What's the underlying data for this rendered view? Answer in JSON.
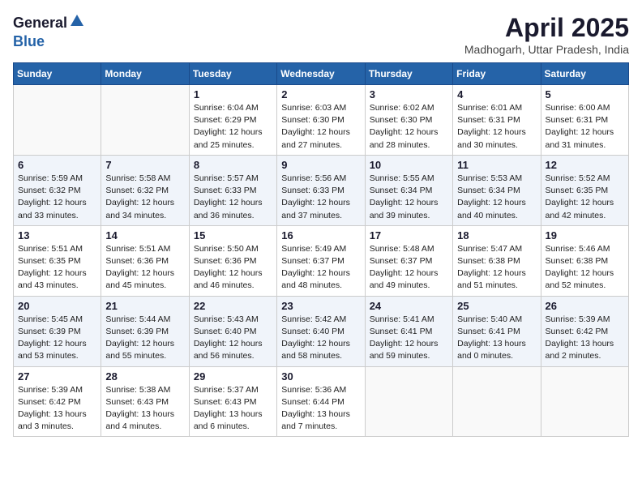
{
  "logo": {
    "general": "General",
    "blue": "Blue"
  },
  "title": "April 2025",
  "location": "Madhogarh, Uttar Pradesh, India",
  "weekdays": [
    "Sunday",
    "Monday",
    "Tuesday",
    "Wednesday",
    "Thursday",
    "Friday",
    "Saturday"
  ],
  "weeks": [
    [
      {
        "day": "",
        "sunrise": "",
        "sunset": "",
        "daylight": ""
      },
      {
        "day": "",
        "sunrise": "",
        "sunset": "",
        "daylight": ""
      },
      {
        "day": "1",
        "sunrise": "Sunrise: 6:04 AM",
        "sunset": "Sunset: 6:29 PM",
        "daylight": "Daylight: 12 hours and 25 minutes."
      },
      {
        "day": "2",
        "sunrise": "Sunrise: 6:03 AM",
        "sunset": "Sunset: 6:30 PM",
        "daylight": "Daylight: 12 hours and 27 minutes."
      },
      {
        "day": "3",
        "sunrise": "Sunrise: 6:02 AM",
        "sunset": "Sunset: 6:30 PM",
        "daylight": "Daylight: 12 hours and 28 minutes."
      },
      {
        "day": "4",
        "sunrise": "Sunrise: 6:01 AM",
        "sunset": "Sunset: 6:31 PM",
        "daylight": "Daylight: 12 hours and 30 minutes."
      },
      {
        "day": "5",
        "sunrise": "Sunrise: 6:00 AM",
        "sunset": "Sunset: 6:31 PM",
        "daylight": "Daylight: 12 hours and 31 minutes."
      }
    ],
    [
      {
        "day": "6",
        "sunrise": "Sunrise: 5:59 AM",
        "sunset": "Sunset: 6:32 PM",
        "daylight": "Daylight: 12 hours and 33 minutes."
      },
      {
        "day": "7",
        "sunrise": "Sunrise: 5:58 AM",
        "sunset": "Sunset: 6:32 PM",
        "daylight": "Daylight: 12 hours and 34 minutes."
      },
      {
        "day": "8",
        "sunrise": "Sunrise: 5:57 AM",
        "sunset": "Sunset: 6:33 PM",
        "daylight": "Daylight: 12 hours and 36 minutes."
      },
      {
        "day": "9",
        "sunrise": "Sunrise: 5:56 AM",
        "sunset": "Sunset: 6:33 PM",
        "daylight": "Daylight: 12 hours and 37 minutes."
      },
      {
        "day": "10",
        "sunrise": "Sunrise: 5:55 AM",
        "sunset": "Sunset: 6:34 PM",
        "daylight": "Daylight: 12 hours and 39 minutes."
      },
      {
        "day": "11",
        "sunrise": "Sunrise: 5:53 AM",
        "sunset": "Sunset: 6:34 PM",
        "daylight": "Daylight: 12 hours and 40 minutes."
      },
      {
        "day": "12",
        "sunrise": "Sunrise: 5:52 AM",
        "sunset": "Sunset: 6:35 PM",
        "daylight": "Daylight: 12 hours and 42 minutes."
      }
    ],
    [
      {
        "day": "13",
        "sunrise": "Sunrise: 5:51 AM",
        "sunset": "Sunset: 6:35 PM",
        "daylight": "Daylight: 12 hours and 43 minutes."
      },
      {
        "day": "14",
        "sunrise": "Sunrise: 5:51 AM",
        "sunset": "Sunset: 6:36 PM",
        "daylight": "Daylight: 12 hours and 45 minutes."
      },
      {
        "day": "15",
        "sunrise": "Sunrise: 5:50 AM",
        "sunset": "Sunset: 6:36 PM",
        "daylight": "Daylight: 12 hours and 46 minutes."
      },
      {
        "day": "16",
        "sunrise": "Sunrise: 5:49 AM",
        "sunset": "Sunset: 6:37 PM",
        "daylight": "Daylight: 12 hours and 48 minutes."
      },
      {
        "day": "17",
        "sunrise": "Sunrise: 5:48 AM",
        "sunset": "Sunset: 6:37 PM",
        "daylight": "Daylight: 12 hours and 49 minutes."
      },
      {
        "day": "18",
        "sunrise": "Sunrise: 5:47 AM",
        "sunset": "Sunset: 6:38 PM",
        "daylight": "Daylight: 12 hours and 51 minutes."
      },
      {
        "day": "19",
        "sunrise": "Sunrise: 5:46 AM",
        "sunset": "Sunset: 6:38 PM",
        "daylight": "Daylight: 12 hours and 52 minutes."
      }
    ],
    [
      {
        "day": "20",
        "sunrise": "Sunrise: 5:45 AM",
        "sunset": "Sunset: 6:39 PM",
        "daylight": "Daylight: 12 hours and 53 minutes."
      },
      {
        "day": "21",
        "sunrise": "Sunrise: 5:44 AM",
        "sunset": "Sunset: 6:39 PM",
        "daylight": "Daylight: 12 hours and 55 minutes."
      },
      {
        "day": "22",
        "sunrise": "Sunrise: 5:43 AM",
        "sunset": "Sunset: 6:40 PM",
        "daylight": "Daylight: 12 hours and 56 minutes."
      },
      {
        "day": "23",
        "sunrise": "Sunrise: 5:42 AM",
        "sunset": "Sunset: 6:40 PM",
        "daylight": "Daylight: 12 hours and 58 minutes."
      },
      {
        "day": "24",
        "sunrise": "Sunrise: 5:41 AM",
        "sunset": "Sunset: 6:41 PM",
        "daylight": "Daylight: 12 hours and 59 minutes."
      },
      {
        "day": "25",
        "sunrise": "Sunrise: 5:40 AM",
        "sunset": "Sunset: 6:41 PM",
        "daylight": "Daylight: 13 hours and 0 minutes."
      },
      {
        "day": "26",
        "sunrise": "Sunrise: 5:39 AM",
        "sunset": "Sunset: 6:42 PM",
        "daylight": "Daylight: 13 hours and 2 minutes."
      }
    ],
    [
      {
        "day": "27",
        "sunrise": "Sunrise: 5:39 AM",
        "sunset": "Sunset: 6:42 PM",
        "daylight": "Daylight: 13 hours and 3 minutes."
      },
      {
        "day": "28",
        "sunrise": "Sunrise: 5:38 AM",
        "sunset": "Sunset: 6:43 PM",
        "daylight": "Daylight: 13 hours and 4 minutes."
      },
      {
        "day": "29",
        "sunrise": "Sunrise: 5:37 AM",
        "sunset": "Sunset: 6:43 PM",
        "daylight": "Daylight: 13 hours and 6 minutes."
      },
      {
        "day": "30",
        "sunrise": "Sunrise: 5:36 AM",
        "sunset": "Sunset: 6:44 PM",
        "daylight": "Daylight: 13 hours and 7 minutes."
      },
      {
        "day": "",
        "sunrise": "",
        "sunset": "",
        "daylight": ""
      },
      {
        "day": "",
        "sunrise": "",
        "sunset": "",
        "daylight": ""
      },
      {
        "day": "",
        "sunrise": "",
        "sunset": "",
        "daylight": ""
      }
    ]
  ]
}
